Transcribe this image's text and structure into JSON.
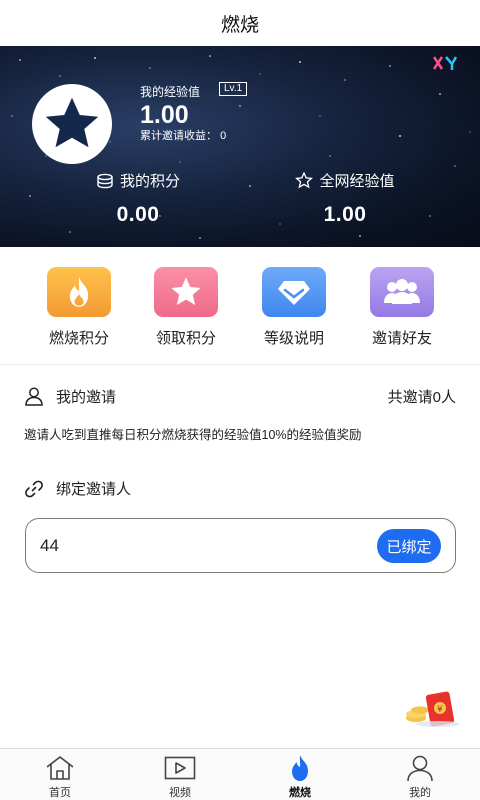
{
  "header": {
    "title": "燃烧"
  },
  "hero": {
    "exp_label": "我的经验值",
    "level": "Lv.1",
    "exp_value": "1.00",
    "earnings_label": "累计邀请收益：",
    "earnings_value": "0",
    "points_label": "我的积分",
    "points_value": "0.00",
    "network_exp_label": "全网经验值",
    "network_exp_value": "1.00"
  },
  "actions": [
    {
      "label": "燃烧积分",
      "icon": "flame-icon",
      "color": "#f6a23b"
    },
    {
      "label": "领取积分",
      "icon": "star-icon",
      "color": "#f47a94"
    },
    {
      "label": "等级说明",
      "icon": "diamond-icon",
      "color": "#4a8ff0"
    },
    {
      "label": "邀请好友",
      "icon": "group-icon",
      "color": "#a88ae8"
    }
  ],
  "invite": {
    "title": "我的邀请",
    "count": "共邀请0人",
    "description": "邀请人吃到直推每日积分燃烧获得的经验值10%的经验值奖励"
  },
  "bind": {
    "title": "绑定邀请人",
    "value": "44",
    "button": "已绑定"
  },
  "tabbar": {
    "items": [
      {
        "label": "首页",
        "icon": "home-icon"
      },
      {
        "label": "视频",
        "icon": "video-icon"
      },
      {
        "label": "燃烧",
        "icon": "flame-icon",
        "active": true
      },
      {
        "label": "我的",
        "icon": "user-icon"
      }
    ]
  },
  "colors": {
    "accent": "#1e6cf0",
    "hero_bg": "#0b1324",
    "star": "#13284a"
  }
}
